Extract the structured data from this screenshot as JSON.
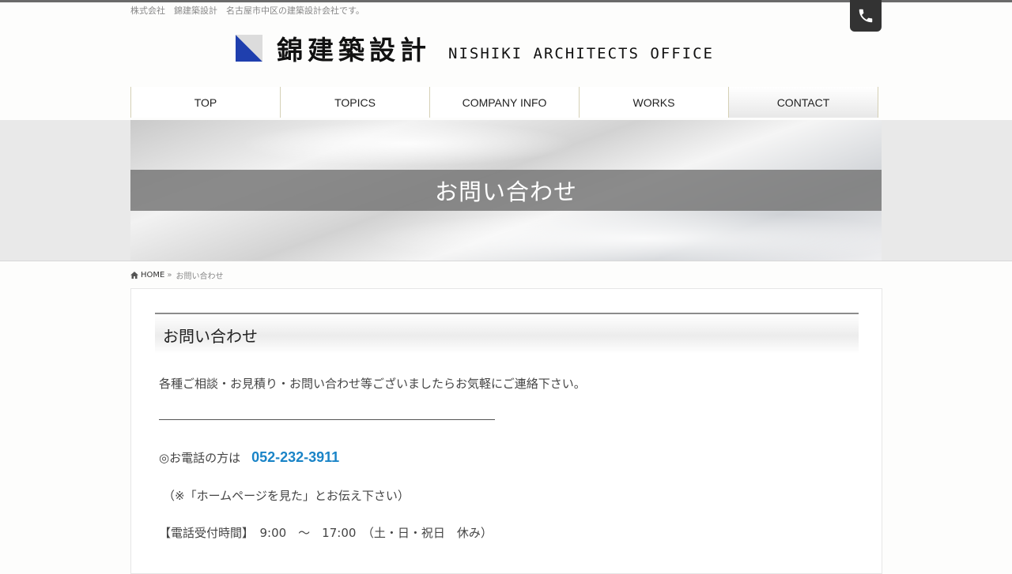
{
  "header": {
    "tagline": "株式会社　錦建築設計　名古屋市中区の建築設計会社です。",
    "logo_jp": "錦建築設計",
    "logo_en": "NISHIKI ARCHITECTS OFFICE",
    "phone_icon": "phone-icon"
  },
  "nav": {
    "items": [
      {
        "label": "TOP"
      },
      {
        "label": "TOPICS"
      },
      {
        "label": "COMPANY INFO"
      },
      {
        "label": "WORKS"
      },
      {
        "label": "CONTACT"
      }
    ],
    "active": "CONTACT"
  },
  "hero": {
    "title": "お問い合わせ"
  },
  "breadcrumb": {
    "home_icon": "home-icon",
    "home": "HOME",
    "separator": "»",
    "current": "お問い合わせ"
  },
  "main": {
    "heading": "お問い合わせ",
    "lead": "各種ご相談・お見積り・お問い合わせ等ございましたらお気軽にご連絡下さい。",
    "phone_label": "◎お電話の方は",
    "phone_number": "052-232-3911",
    "note": "（※「ホームページを見た」とお伝え下さい）",
    "hours": "【電話受付時間】　9:00　～　17:00　（土・日・祝日　休み）"
  },
  "colors": {
    "accent_blue": "#1a84c7",
    "logo_blue": "#1f3fae",
    "band_gray": "#7f7f7f"
  }
}
